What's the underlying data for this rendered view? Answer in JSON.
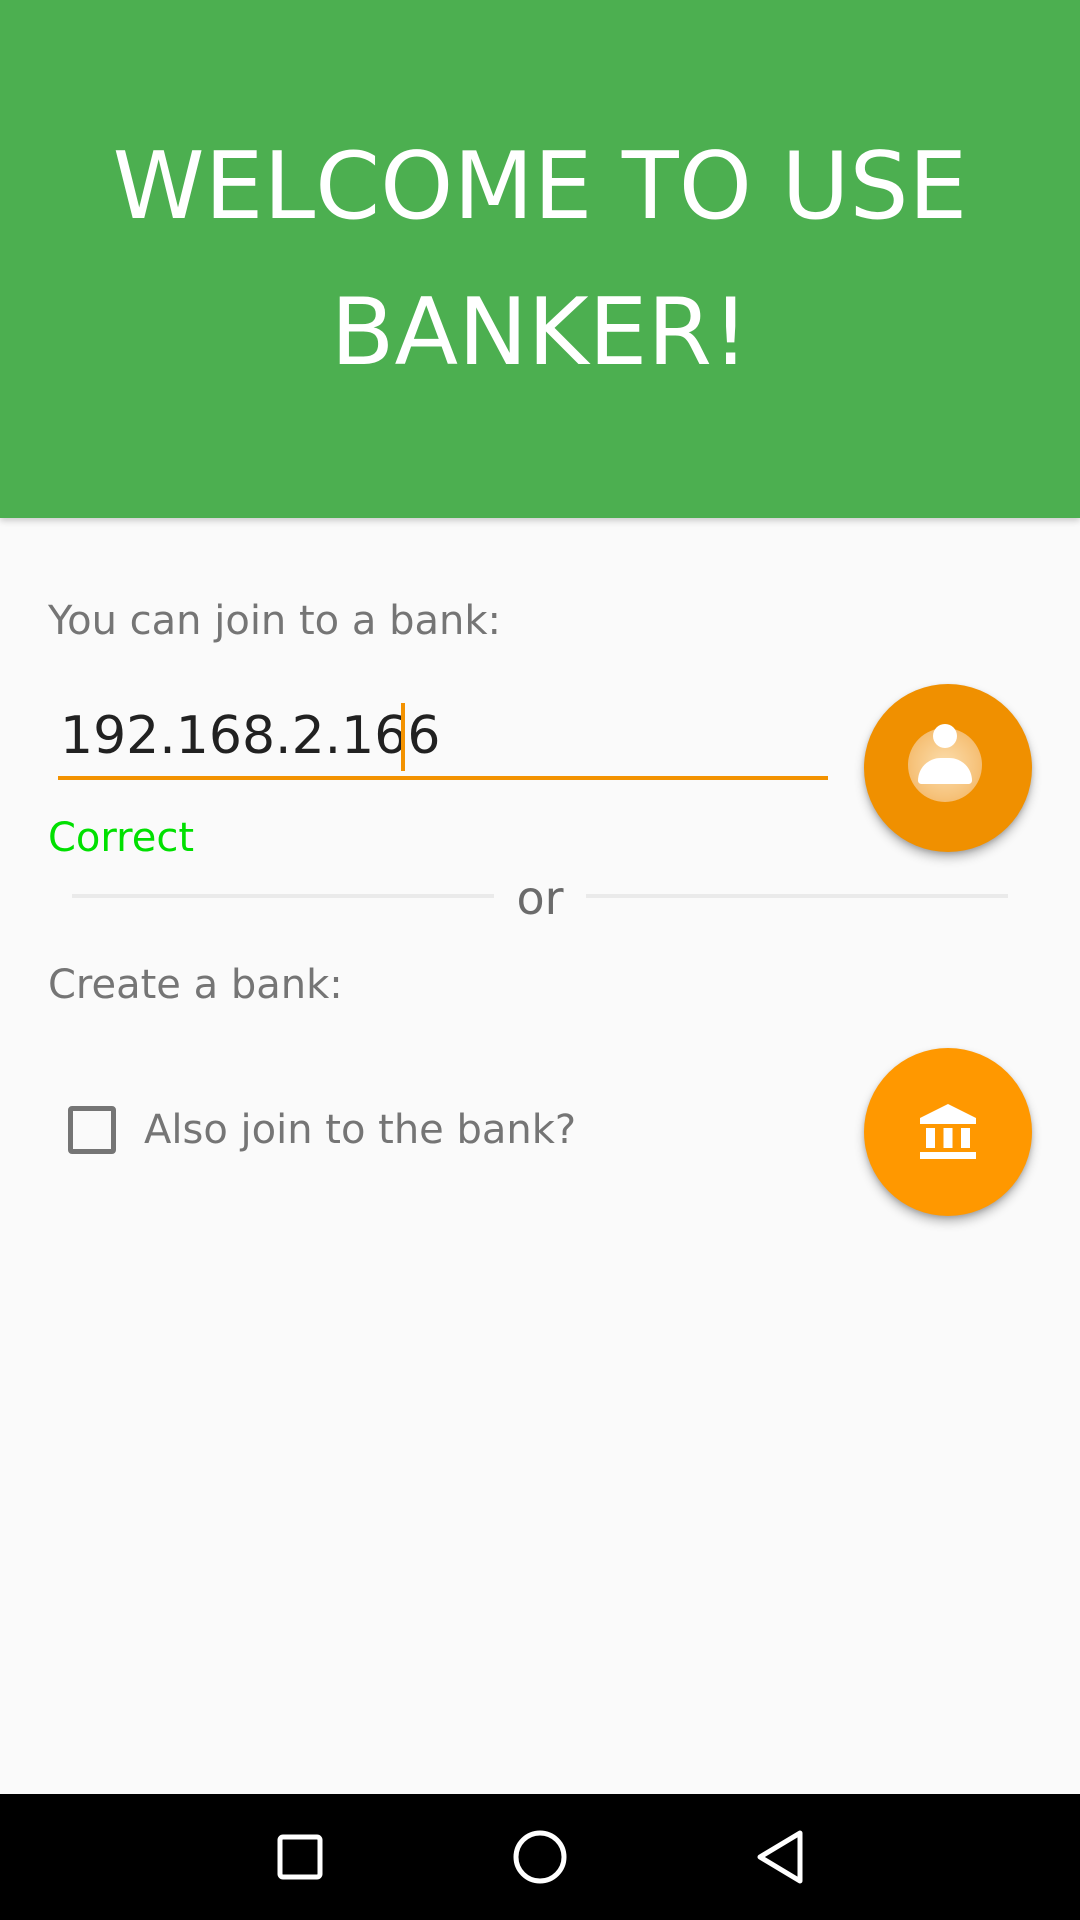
{
  "header": {
    "title": "WELCOME TO USE BANKER!",
    "background_color": "#4caf50"
  },
  "join_section": {
    "label": "You can join to a bank:",
    "ip_value": "192.168.2.166",
    "status": "Correct",
    "status_color": "#00e000",
    "join_button_icon": "person-join-icon"
  },
  "divider": {
    "text": "or"
  },
  "create_section": {
    "label": "Create a bank:",
    "checkbox_label": "Also join to the bank?",
    "checkbox_checked": false,
    "create_button_icon": "bank-icon"
  },
  "accent_color": "#ff9800",
  "navbar": {
    "icons": [
      "recents-square-icon",
      "home-circle-icon",
      "back-triangle-icon"
    ]
  }
}
